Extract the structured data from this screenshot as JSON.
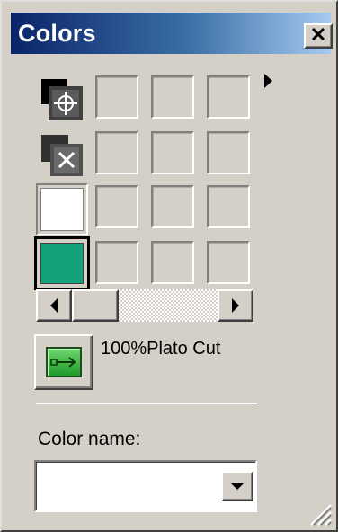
{
  "window": {
    "title": "Colors"
  },
  "titlebar": {
    "close_icon": "close-x-icon"
  },
  "palette": {
    "flyout_icon": "flyout-arrow-icon",
    "special_swatches": [
      {
        "name": "registration",
        "icon": "registration-swatch-icon"
      },
      {
        "name": "none",
        "icon": "none-swatch-icon"
      },
      {
        "name": "fill",
        "color": "#ffffff"
      },
      {
        "name": "active-color",
        "color": "#13a27c"
      }
    ]
  },
  "scrollbar": {
    "left_icon": "scroll-left-icon",
    "right_icon": "scroll-right-icon"
  },
  "color_info": {
    "apply_icon": "apply-color-icon",
    "text": "100%Plato Cut"
  },
  "color_name": {
    "label": "Color name:",
    "value": "",
    "dropdown_icon": "chevron-down-icon"
  },
  "colors": {
    "titlebar_start": "#0a246a",
    "titlebar_end": "#a6caf0",
    "face": "#d4d0c8",
    "active_swatch": "#13a27c"
  }
}
